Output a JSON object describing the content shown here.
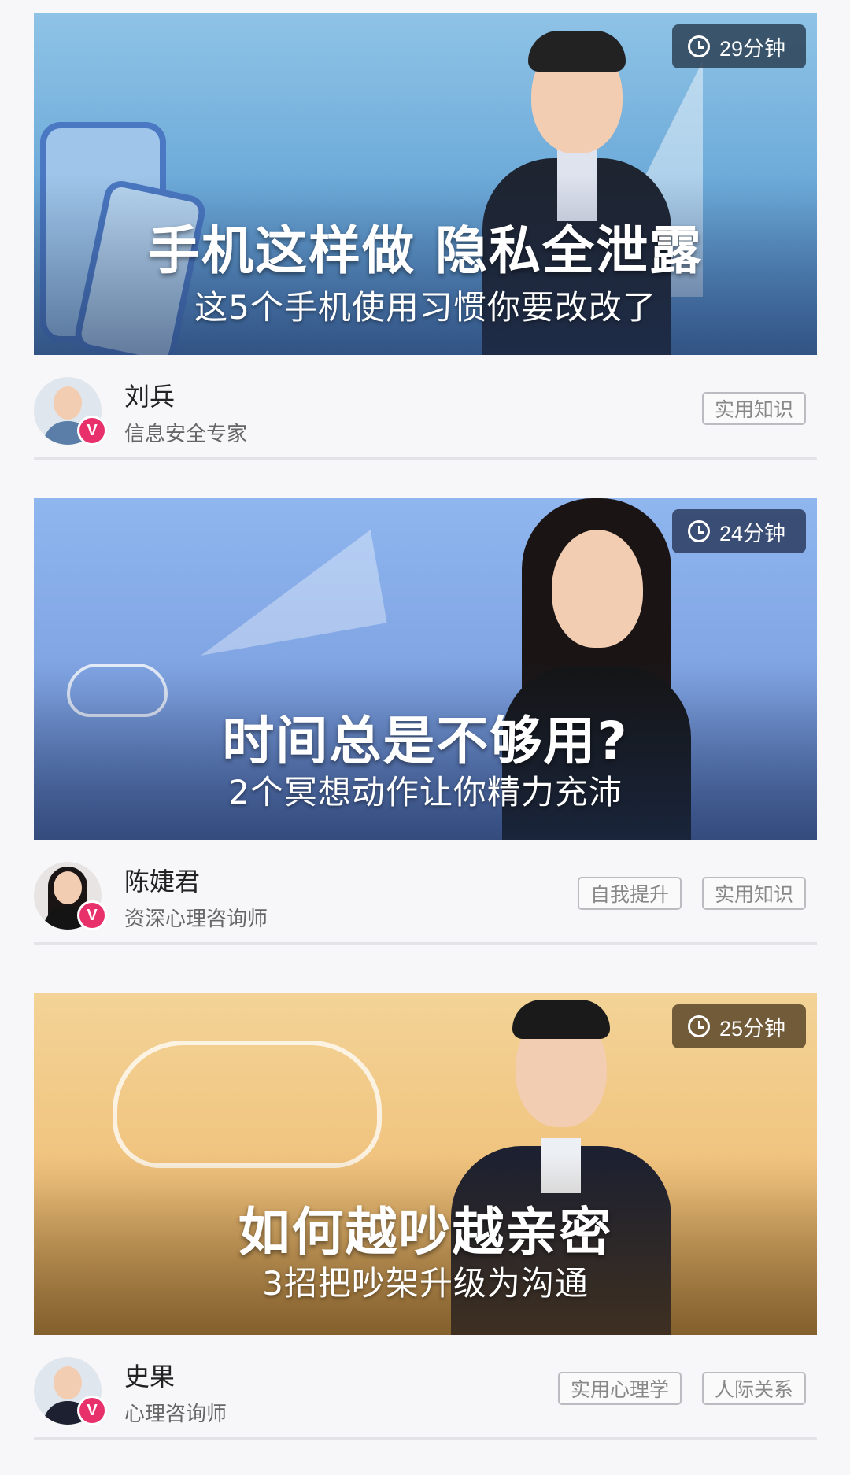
{
  "courses": [
    {
      "duration": "29分钟",
      "title": "手机这样做 隐私全泄露",
      "subtitle": "这5个手机使用习惯你要改改了",
      "author": "刘兵",
      "role": "信息安全专家",
      "tags": [
        "实用知识"
      ]
    },
    {
      "duration": "24分钟",
      "title": "时间总是不够用?",
      "subtitle": "2个冥想动作让你精力充沛",
      "author": "陈婕君",
      "role": "资深心理咨询师",
      "tags": [
        "自我提升",
        "实用知识"
      ]
    },
    {
      "duration": "25分钟",
      "title": "如何越吵越亲密",
      "subtitle": "3招把吵架升级为沟通",
      "author": "史果",
      "role": "心理咨询师",
      "tags": [
        "实用心理学",
        "人际关系"
      ]
    }
  ],
  "badge_letter": "V",
  "colors": {
    "badge": "#e8306b",
    "tag_border": "#bbbbc2"
  }
}
